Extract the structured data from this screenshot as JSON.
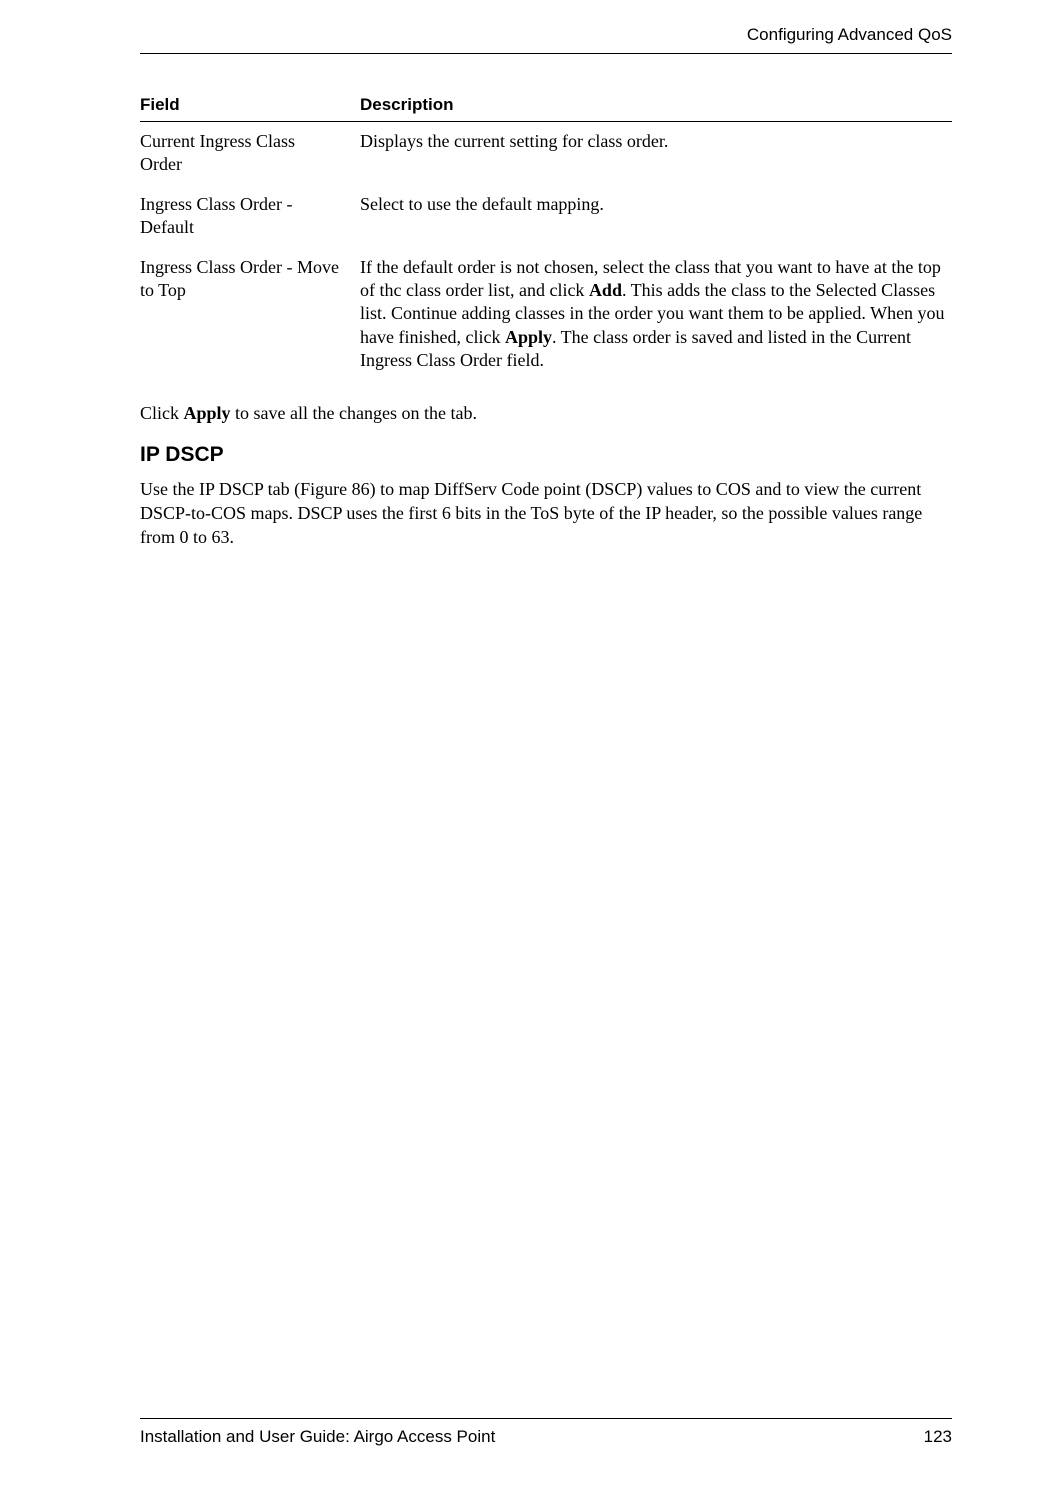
{
  "header": {
    "section_title": "Configuring Advanced QoS"
  },
  "table": {
    "headers": {
      "field": "Field",
      "description": "Description"
    },
    "rows": [
      {
        "field": "Current Ingress Class Order",
        "description_plain": "Displays the current setting for class order."
      },
      {
        "field": "Ingress Class Order - Default",
        "description_plain": "Select to use the default mapping."
      },
      {
        "field": "Ingress Class Order - Move to Top",
        "description_parts": {
          "p1": "If the default order is not chosen, select the class that you want to have at the top of thc class order list, and click ",
          "b1": "Add",
          "p2": ". This adds the class to the Selected Classes list. Continue adding classes in the order you want them to be applied. When you have finished, click ",
          "b2": "Apply",
          "p3": ". The class order is saved and listed in the Current Ingress Class Order field."
        }
      }
    ]
  },
  "body": {
    "apply_para": {
      "p1": "Click ",
      "b1": "Apply",
      "p2": " to save all the changes on the tab."
    },
    "section_heading": "IP DSCP",
    "ip_dscp_para": {
      "p1": "Use the IP DSCP tab (Figure 86) to map ",
      "p2": "DiffServ Code point (DSCP) values to COS and to view the current DSCP-to-COS maps. DSCP uses the first 6 bits in the ToS byte of the IP header, so the possible values range from 0 to 63."
    }
  },
  "footer": {
    "left": "Installation and User Guide: Airgo Access Point",
    "right": "123"
  }
}
